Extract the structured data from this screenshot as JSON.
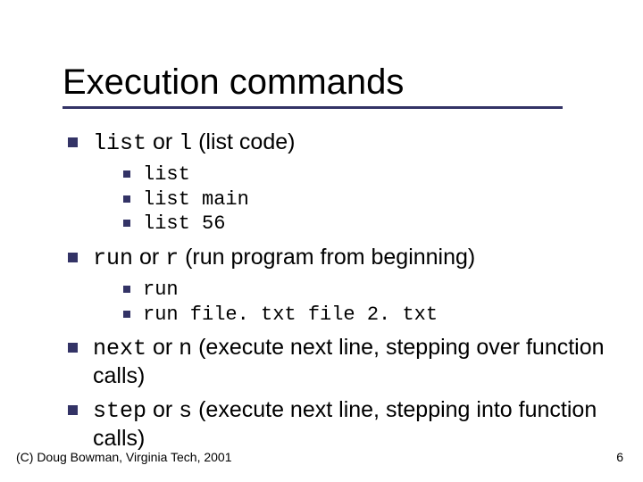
{
  "title": "Execution commands",
  "bullets": {
    "list": {
      "cmd": "list",
      "alt": "l",
      "desc_open": " (list code)",
      "sub": [
        "list",
        "list main",
        "list 56"
      ]
    },
    "run": {
      "cmd": "run",
      "alt": "r",
      "desc_open": " (run program from beginning)",
      "sub": [
        "run",
        "run file. txt file 2. txt"
      ]
    },
    "next": {
      "cmd": "next",
      "alt": "n",
      "desc_rest": "  (execute next line, stepping over function calls)"
    },
    "step": {
      "cmd": "step",
      "alt": "s",
      "desc_rest": "  (execute next line, stepping into function calls)"
    }
  },
  "or_word": " or ",
  "footer": {
    "copyright": "(C) Doug Bowman, Virginia Tech, 2001",
    "page": "6"
  }
}
